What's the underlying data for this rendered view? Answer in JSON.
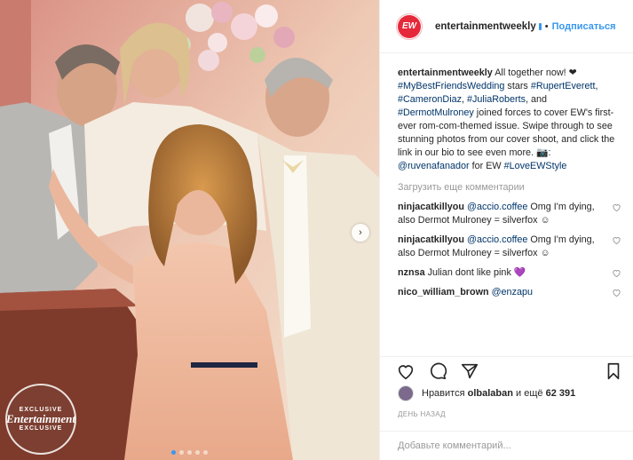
{
  "post": {
    "account": "entertainmentweekly",
    "avatar_text": "EW",
    "separator": "•",
    "follow_label": "Подписаться",
    "caption": {
      "username": "entertainmentweekly",
      "part1": " All together now! ❤ ",
      "tag1": "#MyBestFriendsWedding",
      "part2": " stars ",
      "tag2": "#RupertEverett",
      "sep1": ", ",
      "tag3": "#CameronDiaz",
      "sep2": ", ",
      "tag4": "#JuliaRoberts",
      "part3": ", and ",
      "tag5": "#DermotMulroney",
      "part4": " joined forces to cover EW's first-ever rom-com-themed issue. Swipe through to see stunning photos from our cover shoot, and click the link in our bio to see even more. 📷: ",
      "tag6": "@ruvenafanador",
      "part5": " for EW ",
      "tag7": "#LoveEWStyle"
    },
    "load_more": "Загрузить еще комментарии",
    "comments": [
      {
        "username": "ninjacatkillyou",
        "mention": "@accio.coffee",
        "text": " Omg I'm dying, also Dermot Mulroney = silverfox ☺"
      },
      {
        "username": "ninjacatkillyou",
        "mention": "@accio.coffee",
        "text": " Omg I'm dying, also Dermot Mulroney = silverfox ☺"
      },
      {
        "username": "nznsa",
        "mention": "",
        "text": "Julian dont like pink 💜"
      },
      {
        "username": "nico_william_brown",
        "mention": "@enzapu",
        "text": ""
      }
    ],
    "likes": {
      "prefix": "Нравится ",
      "user": "olbalaban",
      "middle": " и ещё ",
      "count": "62 391"
    },
    "time_ago": "ДЕНЬ НАЗАД",
    "comment_placeholder": "Добавьте комментарий...",
    "stamp": {
      "top": "EXCLUSIVE",
      "brand": "Entertainment",
      "bottom": "EXCLUSIVE"
    },
    "carousel": {
      "slides": 5,
      "active": 0
    }
  },
  "colors": {
    "accent": "#3897f0",
    "brand_red": "#e5293a",
    "hashtag": "#003569",
    "muted": "#999999"
  }
}
